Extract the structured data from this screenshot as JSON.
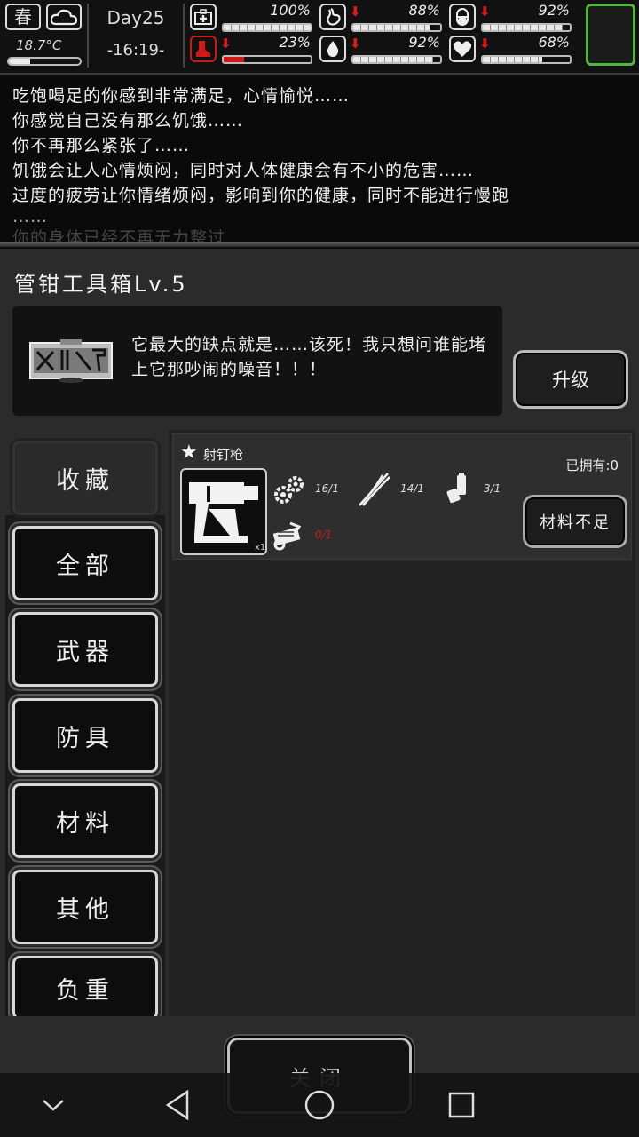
{
  "status": {
    "season": "春",
    "temperature": "18.7°C",
    "temperature_level": 0.3,
    "day": "Day25",
    "time": "-16:19-",
    "stats": [
      {
        "name": "health",
        "icon": "medkit-icon",
        "value": "100%",
        "level": 1.0,
        "falling": false
      },
      {
        "name": "hunger",
        "icon": "stomach-icon",
        "value": "88%",
        "level": 0.88,
        "falling": true
      },
      {
        "name": "energy",
        "icon": "pill-icon",
        "value": "92%",
        "level": 0.92,
        "falling": true
      },
      {
        "name": "fatigue",
        "icon": "boot-icon",
        "value": "23%",
        "level": 0.23,
        "falling": true
      },
      {
        "name": "thirst",
        "icon": "water-drop-icon",
        "value": "92%",
        "level": 0.92,
        "falling": true
      },
      {
        "name": "mood",
        "icon": "heart-icon",
        "value": "68%",
        "level": 0.68,
        "falling": true
      }
    ],
    "accent_green": "#55b43c",
    "alert_red": "#d01818"
  },
  "log": [
    "吃饱喝足的你感到非常满足，心情愉悦……",
    "你感觉自己没有那么饥饿……",
    "你不再那么紧张了……",
    "饥饿会让人心情烦闷，同时对人体健康会有不小的危害……",
    "过度的疲劳让你情绪烦闷，影响到你的健康，同时不能进行慢跑",
    "……",
    "你的身体已经不再无力整过"
  ],
  "toolbox": {
    "title": "管钳工具箱Lv.5",
    "description": "它最大的缺点就是……该死！我只想问谁能堵上它那吵闹的噪音！！！",
    "upgrade_label": "升级"
  },
  "tabs": [
    {
      "label": "收藏",
      "active": true
    },
    {
      "label": "全部",
      "active": false
    },
    {
      "label": "武器",
      "active": false
    },
    {
      "label": "防具",
      "active": false
    },
    {
      "label": "材料",
      "active": false
    },
    {
      "label": "其他",
      "active": false
    },
    {
      "label": "负重",
      "active": false
    }
  ],
  "recipe": {
    "name": "射钉枪",
    "owned": "已拥有:0",
    "output_qty": "x1",
    "materials": [
      {
        "icon": "gears-icon",
        "count": "16/1",
        "ok": true
      },
      {
        "icon": "wire-icon",
        "count": "14/1",
        "ok": true
      },
      {
        "icon": "battery-icon",
        "count": "3/1",
        "ok": true
      },
      {
        "icon": "machine-parts-icon",
        "count": "0/1",
        "ok": false
      }
    ],
    "craft_label": "材料不足"
  },
  "close_label": "关闭"
}
